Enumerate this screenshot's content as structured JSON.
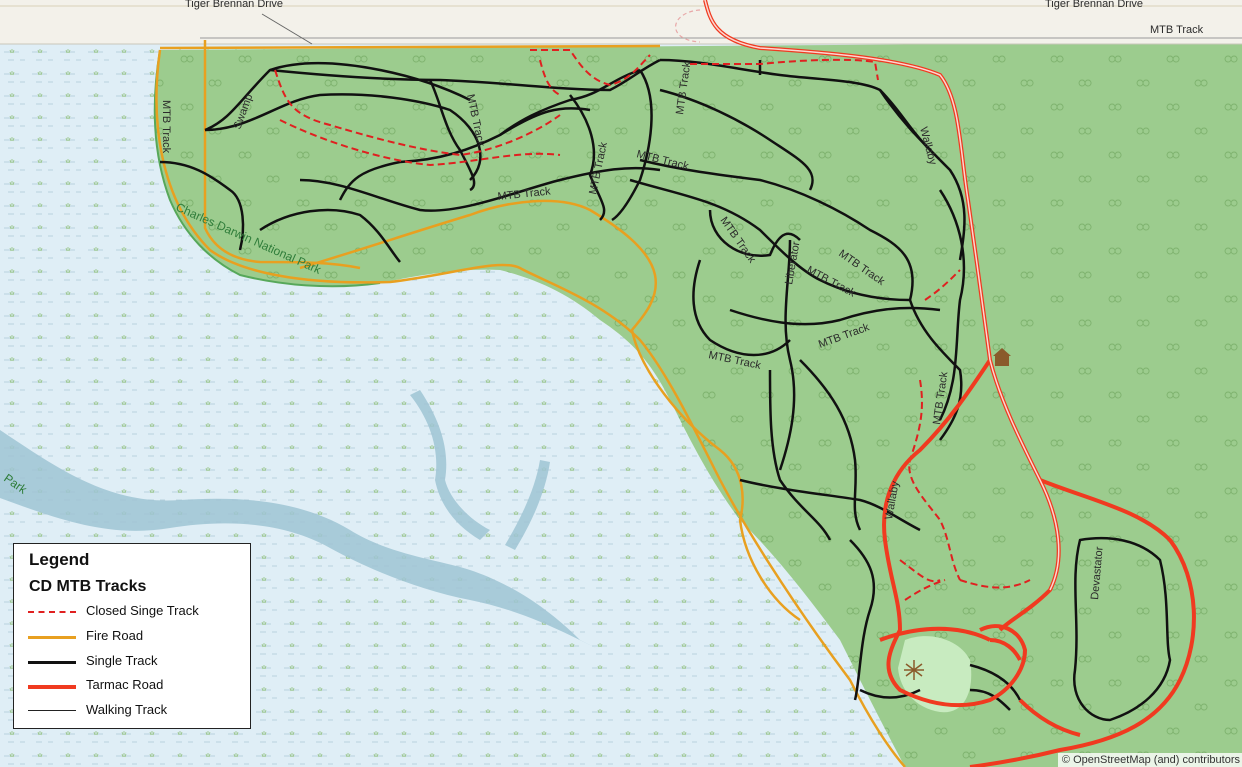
{
  "map": {
    "colors": {
      "water": "#dfeef6",
      "marsh_dash": "#b7cfdc",
      "park": "#9ccc8e",
      "river": "#9fc4d3",
      "road_top": "#f3f1ea",
      "closed_singletrack": "#e02020",
      "fire_road": "#e8a020",
      "single_track": "#111111",
      "tarmac_road": "#f03a20",
      "walking_track": "#222222"
    },
    "street_labels": {
      "tiger_brennan_left": "Tiger Brennan Drive",
      "tiger_brennan_right": "Tiger Brennan Drive",
      "mtb_track_top": "MTB Track"
    },
    "track_labels": {
      "mtb_1": "MTB Track",
      "mtb_2": "MTB Track",
      "mtb_3": "MTB Track",
      "mtb_4": "MTB Track",
      "mtb_5": "MTB Track",
      "mtb_6": "MTB Track",
      "mtb_7": "MTB Track",
      "mtb_8": "MTB Track",
      "mtb_9": "MTB Track",
      "mtb_10": "MTB Track",
      "mtb_11": "MTB Track",
      "mtb_12": "MTB Track",
      "liberator": "Liberator",
      "devastator": "Devastator",
      "wallaby": "Wallaby",
      "swamp": "Swamp",
      "park_name": "Charles Darwin National Park",
      "park_fragment": "Park"
    },
    "attribution": "© OpenStreetMap (and) contributors"
  },
  "legend": {
    "title": "Legend",
    "subtitle": "CD MTB Tracks",
    "items": [
      {
        "label": "Closed Singe Track",
        "color": "#e02020",
        "style": "dashed"
      },
      {
        "label": "Fire Road",
        "color": "#e8a020",
        "style": "solid"
      },
      {
        "label": "Single Track",
        "color": "#111111",
        "style": "solid"
      },
      {
        "label": "Tarmac Road",
        "color": "#f03a20",
        "style": "thick"
      },
      {
        "label": "Walking Track",
        "color": "#222222",
        "style": "thin"
      }
    ]
  }
}
